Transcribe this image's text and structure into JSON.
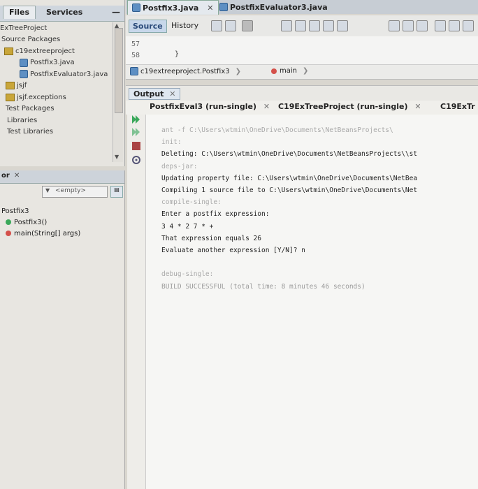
{
  "projects_panel": {
    "tabs": [
      "Files",
      "Services"
    ],
    "minimize": "—",
    "tree": [
      {
        "label": "ExTreeProject",
        "icon": "none"
      },
      {
        "label": "Source Packages",
        "icon": "none"
      },
      {
        "label": "c19extreeproject",
        "icon": "package-icon"
      },
      {
        "label": "Postfix3.java",
        "icon": "java-file-icon"
      },
      {
        "label": "PostfixEvaluator3.java",
        "icon": "java-file-icon"
      },
      {
        "label": "jsjf",
        "icon": "package-icon"
      },
      {
        "label": "jsjf.exceptions",
        "icon": "package-icon"
      },
      {
        "label": "Test Packages",
        "icon": "none"
      },
      {
        "label": "Libraries",
        "icon": "none"
      },
      {
        "label": "Test Libraries",
        "icon": "none"
      }
    ]
  },
  "navigator": {
    "tab_label": "or",
    "close": "✕",
    "filter_value": "<empty>",
    "items": [
      {
        "label": "Postfix3",
        "icon": "none"
      },
      {
        "label": "Postfix3()",
        "icon": "constructor-icon"
      },
      {
        "label": "main(String[] args)",
        "icon": "method-icon"
      }
    ]
  },
  "editor": {
    "tabs": [
      {
        "label": "Postfix3.java",
        "close": "✕"
      },
      {
        "label": "PostfixEvaluator3.java"
      }
    ],
    "source_label": "Source",
    "history_label": "History",
    "gutter": [
      "57",
      "58"
    ],
    "code_lines": [
      "",
      "}"
    ],
    "breadcrumb": [
      "c19extreeproject.Postfix3",
      "main"
    ]
  },
  "output": {
    "title": "Output",
    "close": "✕",
    "subtabs": [
      {
        "label": "PostfixEval3 (run-single)",
        "close": "✕"
      },
      {
        "label": "C19ExTreeProject (run-single)",
        "close": "✕"
      },
      {
        "label": "C19ExTr"
      }
    ],
    "lines": [
      {
        "text": "ant -f C:\\Users\\wtmin\\OneDrive\\Documents\\NetBeansProjects\\",
        "style": "faint"
      },
      {
        "text": "init:",
        "style": "faint"
      },
      {
        "text": "Deleting: C:\\Users\\wtmin\\OneDrive\\Documents\\NetBeansProjects\\\\st",
        "style": "normal"
      },
      {
        "text": "deps-jar:",
        "style": "faint"
      },
      {
        "text": "Updating property file: C:\\Users\\wtmin\\OneDrive\\Documents\\NetBea",
        "style": "normal"
      },
      {
        "text": "Compiling 1 source file to C:\\Users\\wtmin\\OneDrive\\Documents\\Net",
        "style": "normal"
      },
      {
        "text": "compile-single:",
        "style": "faint"
      },
      {
        "text": "Enter a postfix expression:",
        "style": "normal"
      },
      {
        "text": "3 4 * 2 7 * +",
        "style": "normal"
      },
      {
        "text": "That expression equals 26",
        "style": "normal"
      },
      {
        "text": "Evaluate another expression [Y/N]? n",
        "style": "normal"
      },
      {
        "text": "",
        "style": "normal"
      },
      {
        "text": "debug-single:",
        "style": "faint"
      },
      {
        "text": "BUILD SUCCESSFUL (total time: 8 minutes 46 seconds)",
        "style": "success"
      }
    ]
  },
  "colors": {
    "background": "#d9d6cf",
    "accent": "#2a4a7a",
    "run_green": "#3aa85a"
  }
}
